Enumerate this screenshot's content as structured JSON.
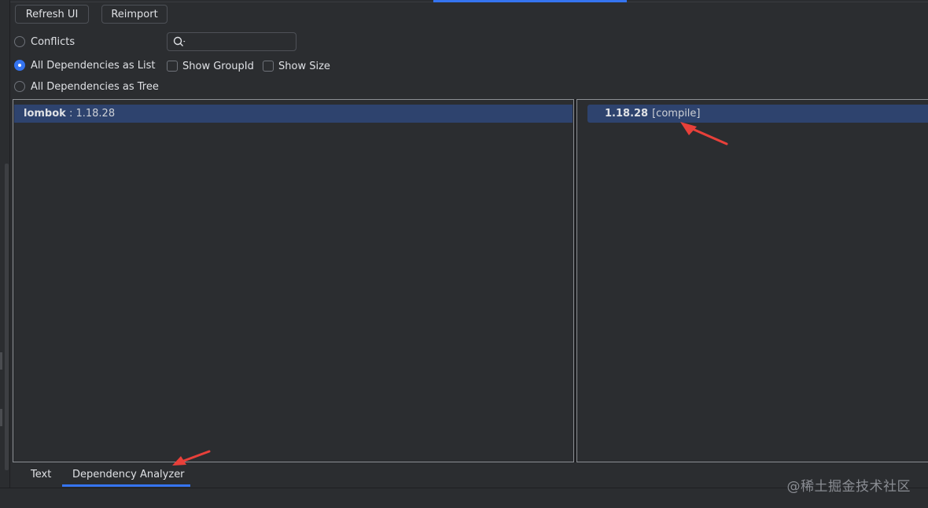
{
  "toolbar": {
    "refresh_label": "Refresh UI",
    "reimport_label": "Reimport"
  },
  "view_mode": {
    "options": [
      {
        "label": "Conflicts",
        "checked": false
      },
      {
        "label": "All Dependencies as List",
        "checked": true
      },
      {
        "label": "All Dependencies as Tree",
        "checked": false
      }
    ]
  },
  "options": {
    "show_groupid_label": "Show GroupId",
    "show_groupid_checked": false,
    "show_size_label": "Show Size",
    "show_size_checked": false
  },
  "search": {
    "value": "",
    "placeholder": ""
  },
  "left_list": {
    "items": [
      {
        "name": "lombok",
        "separator": " : ",
        "version": "1.18.28",
        "selected": true
      }
    ]
  },
  "right_list": {
    "items": [
      {
        "version": "1.18.28",
        "scope": "[compile]",
        "selected": true
      }
    ]
  },
  "bottom_tabs": {
    "tabs": [
      {
        "label": "Text",
        "active": false
      },
      {
        "label": "Dependency Analyzer",
        "active": true
      }
    ]
  },
  "watermark": "@稀土掘金技术社区",
  "colors": {
    "accent": "#3574f0",
    "selection": "#2e436e",
    "annotation_arrow": "#e8403a",
    "background": "#2b2d30"
  },
  "icons": {
    "search": "search-icon",
    "annotation": "red-arrow-icon"
  }
}
